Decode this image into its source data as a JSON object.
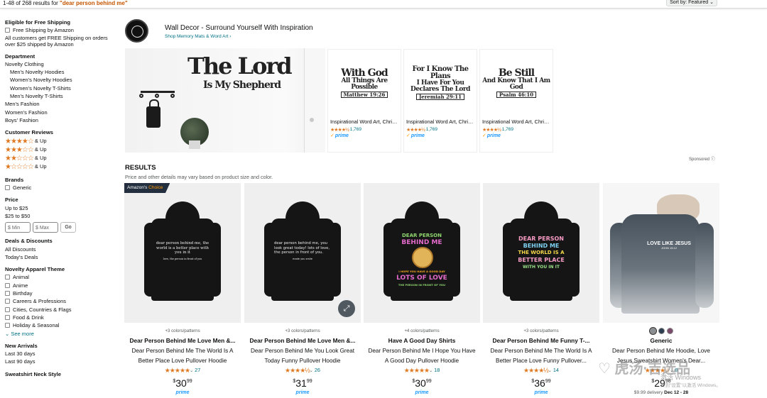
{
  "topbar": {
    "results_prefix": "1-48 of 268 results for ",
    "query": "\"dear person behind me\"",
    "sort_label": "Sort by: Featured"
  },
  "sidebar": {
    "free_shipping_heading": "Eligible for Free Shipping",
    "free_shipping_option": "Free Shipping by Amazon",
    "free_shipping_note": "All customers get FREE Shipping on orders over $25 shipped by Amazon",
    "department_heading": "Department",
    "departments": [
      "Novelty Clothing",
      "Men's Novelty Hoodies",
      "Women's Novelty Hoodies",
      "Women's Novelty T-Shirts",
      "Men's Novelty T-Shirts",
      "Men's Fashion",
      "Women's Fashion",
      "Boys' Fashion"
    ],
    "reviews_heading": "Customer Reviews",
    "review_rows": [
      {
        "stars": "★★★★☆",
        "label": "& Up"
      },
      {
        "stars": "★★★☆☆",
        "label": "& Up"
      },
      {
        "stars": "★★☆☆☆",
        "label": "& Up"
      },
      {
        "stars": "★☆☆☆☆",
        "label": "& Up"
      }
    ],
    "brands_heading": "Brands",
    "brand_option": "Generic",
    "price_heading": "Price",
    "price_ranges": [
      "Up to $25",
      "$25 to $50"
    ],
    "price_min_placeholder": "$ Min",
    "price_max_placeholder": "$ Max",
    "go_label": "Go",
    "deals_heading": "Deals & Discounts",
    "deals": [
      "All Discounts",
      "Today's Deals"
    ],
    "theme_heading": "Novelty Apparel Theme",
    "themes": [
      "Animal",
      "Anime",
      "Birthday",
      "Careers & Professions",
      "Cities, Countries & Flags",
      "Food & Drink",
      "Holiday & Seasonal"
    ],
    "see_more": "See more",
    "arrivals_heading": "New Arrivals",
    "arrivals": [
      "Last 30 days",
      "Last 90 days"
    ],
    "neck_heading": "Sweatshirt Neck Style"
  },
  "brand_banner": {
    "title": "Wall Decor - Surround Yourself With Inspiration",
    "link": "Shop Memory Mats & Word Art ›",
    "hero_line1": "The Lord",
    "hero_line2": "Is My Shepherd"
  },
  "sponsored_products": [
    {
      "art_main": "With God",
      "art_sub": "All Things Are Possible",
      "art_ref": "Matthew 19:26",
      "title": "Inspirational Word Art, Christian Faith Biblical V...",
      "stars": "★★★★½",
      "reviews": "1,769",
      "prime": "prime"
    },
    {
      "art_main": "For I Know The Plans",
      "art_sub": "I Have For You Declares The Lord",
      "art_ref": "Jeremiah 29:11",
      "title": "Inspirational Word Art, Christian Faith Biblical V...",
      "stars": "★★★★½",
      "reviews": "1,769",
      "prime": "prime"
    },
    {
      "art_main": "Be Still",
      "art_sub": "And Know That I Am God",
      "art_ref": "Psalm 46:10",
      "title": "Inspirational Word Art, Christian Faith Biblical V...",
      "stars": "★★★★½",
      "reviews": "1,769",
      "prime": "prime"
    }
  ],
  "sponsored_label": "Sponsored ⓘ",
  "results": {
    "heading": "RESULTS",
    "subheading": "Price and other details may vary based on product size and color."
  },
  "products": [
    {
      "badge_prefix": "Amazon's",
      "badge_suffix": "Choice",
      "meta": "+3 colors/patterns",
      "brand": "Dear Person Behind Me Love Men &...",
      "desc": "Dear Person Behind Me The World Is A Better Place Love Pullover Hoodie",
      "stars": "★★★★★",
      "reviews": "27",
      "price_whole": "30",
      "price_frac": "99",
      "prime": "prime",
      "print": "dear person behind me, the world is a better place with you in it",
      "print_small": "love, the person in front of you"
    },
    {
      "meta": "+3 colors/patterns",
      "brand": "Dear Person Behind Me Love Men &...",
      "desc": "Dear Person Behind Me You Look Great Today Funny Pullover Hoodie",
      "stars": "★★★★½",
      "reviews": "26",
      "price_whole": "31",
      "price_frac": "99",
      "prime": "prime",
      "print": "dear person behind me, you look great today! lots of love, the person in front of you.",
      "print_small": "made you smile"
    },
    {
      "meta": "+4 colors/patterns",
      "brand": "Have A Good Day Shirts",
      "desc": "Dear Person Behind Me I Hope You Have A Good Day Pullover Hoodie",
      "stars": "★★★★★",
      "reviews": "18",
      "price_whole": "30",
      "price_frac": "99",
      "prime": "prime",
      "print_top": "DEAR PERSON",
      "print_top2": "BEHIND ME",
      "print_arc": "I HOPE YOU HAVE A GOOD DAY",
      "print_bottom": "LOTS OF LOVE",
      "print_small": "THE PERSON IN FRONT OF YOU"
    },
    {
      "meta": "+3 colors/patterns",
      "brand": "Dear Person Behind Me Funny T-...",
      "desc": "Dear Person Behind Me The World Is A Better Place Love Funny Pullover...",
      "stars": "★★★★½",
      "reviews": "14",
      "price_whole": "36",
      "price_frac": "99",
      "prime": "prime",
      "print_l1": "DEAR PERSON",
      "print_l2": "BEHIND ME",
      "print_l3": "THE WORLD IS A",
      "print_l4": "BETTER PLACE",
      "print_l5": "WITH YOU IN IT"
    },
    {
      "swatches": [
        "#8a8f93",
        "#2c3e50",
        "#7a4a6a"
      ],
      "brand": "Generic",
      "desc": "Dear Person Behind Me Hoodie, Love Jesus Sweatshirt Women's Dear...",
      "stars": "★★★★☆",
      "reviews": "8",
      "price_whole": "29",
      "price_frac": "98",
      "delivery_prefix": "$9.99 delivery ",
      "delivery_date": "Dec 12 - 28",
      "print": "LOVE LIKE JESUS",
      "print_small": "JOHN 15:12"
    }
  ],
  "watermark": {
    "brand": "♡ 虎汤·吉选品",
    "os_line1": "激活 Windows",
    "os_line2": "转到\"设置\"以激活 Windows。"
  },
  "colors": {
    "link": "#007185",
    "star": "#de7921",
    "query": "#c45500",
    "prime": "#1a98ff",
    "badge_bg": "#232f3e"
  }
}
